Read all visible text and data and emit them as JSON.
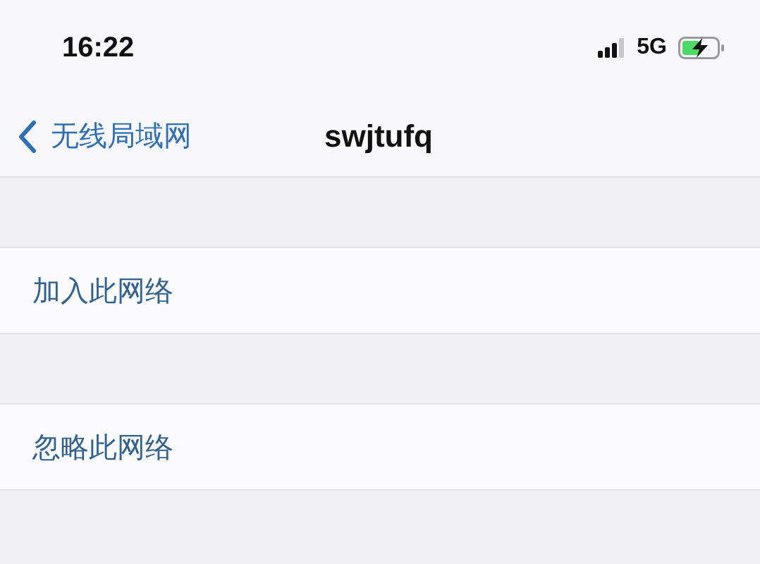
{
  "status_bar": {
    "time": "16:22",
    "network": "5G"
  },
  "nav_bar": {
    "back_label": "无线局域网",
    "title": "swjtufq"
  },
  "actions": [
    {
      "label": "加入此网络"
    },
    {
      "label": "忽略此网络"
    }
  ]
}
